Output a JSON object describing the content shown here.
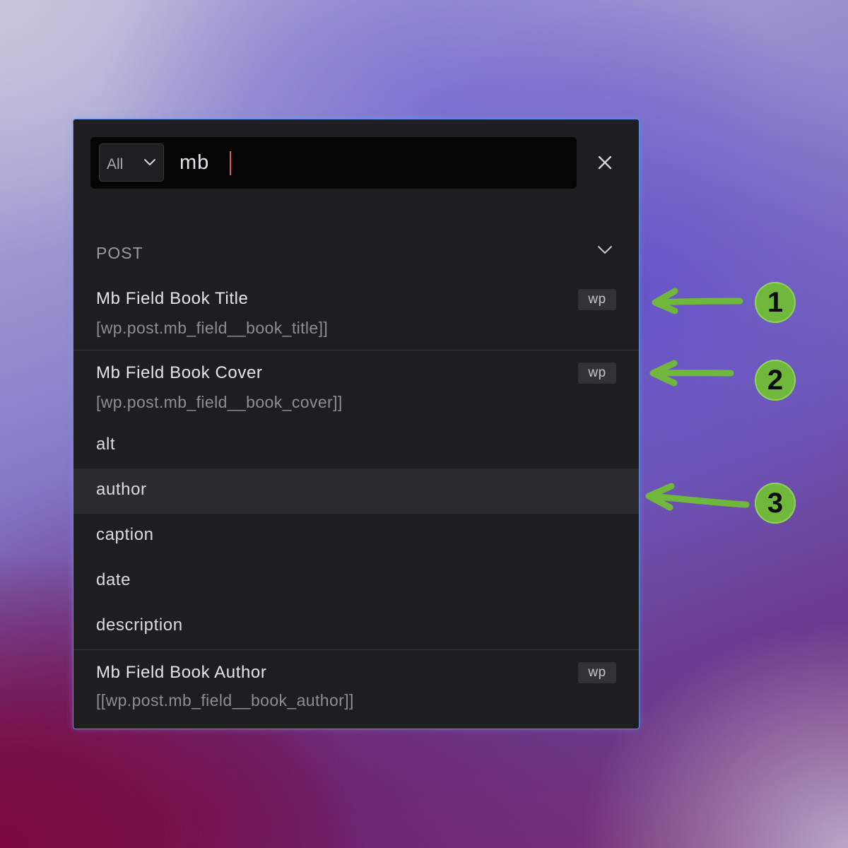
{
  "search": {
    "scope_value": "All",
    "query": "mb"
  },
  "section": {
    "title": "POST"
  },
  "fields": [
    {
      "title": "Mb Field Book Title",
      "tag": "wp",
      "code": "[wp.post.mb_field__book_title]]"
    },
    {
      "title": "Mb Field Book Cover",
      "tag": "wp",
      "code": "[wp.post.mb_field__book_cover]]",
      "subfields": [
        "alt",
        "author",
        "caption",
        "date",
        "description"
      ]
    },
    {
      "title": "Mb Field Book Author",
      "tag": "wp",
      "code": "[[wp.post.mb_field__book_author]]"
    }
  ],
  "callouts": [
    "1",
    "2",
    "3"
  ],
  "colors": {
    "accent_border": "#5b8fe0",
    "caret": "#e0556a",
    "callout_green": "#6fb83c",
    "highlight_row": "#2c2c30"
  },
  "icons": {
    "close": "close-icon",
    "dropdown": "chevron-down-icon",
    "arrow": "arrow-left-icon"
  }
}
